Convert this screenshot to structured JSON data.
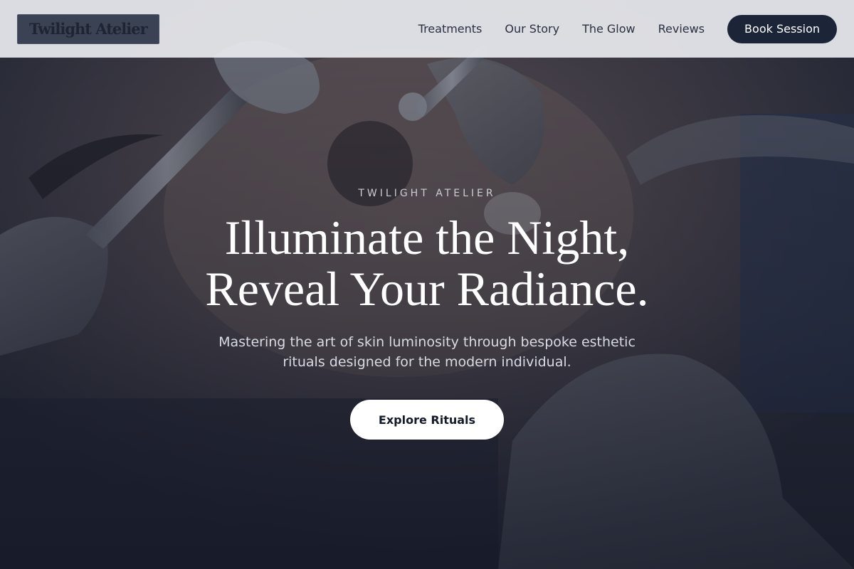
{
  "brand": {
    "logo_text": "Twilight Atelier"
  },
  "nav": {
    "links": [
      {
        "label": "Treatments"
      },
      {
        "label": "Our Story"
      },
      {
        "label": "The Glow"
      },
      {
        "label": "Reviews"
      }
    ],
    "cta_label": "Book Session"
  },
  "hero": {
    "eyebrow": "TWILIGHT ATELIER",
    "headline_line1": "Illuminate the Night,",
    "headline_line2": "Reveal Your Radiance.",
    "subtitle": "Mastering the art of skin luminosity through bespoke esthetic rituals designed for the modern individual.",
    "cta_label": "Explore Rituals",
    "background_image": "facial-treatment-photo"
  },
  "colors": {
    "nav_background": "#e8eaee",
    "logo_background": "#3a4254",
    "primary_dark": "#1c2437",
    "text_light": "#ffffff",
    "cta_light": "#ffffff"
  }
}
